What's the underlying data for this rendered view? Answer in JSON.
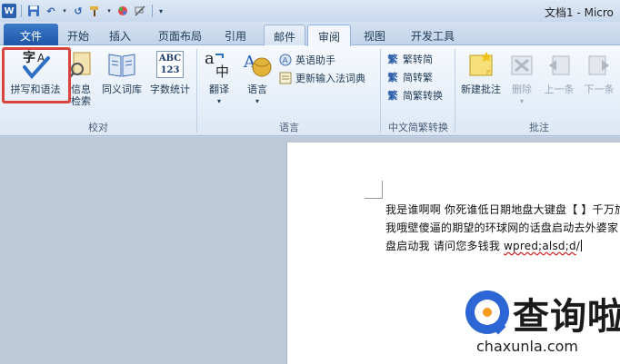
{
  "window": {
    "title": "文档1 - Micro"
  },
  "qat": {
    "app_icon": "W",
    "undo_icon": "↶",
    "redo_icon": "↺"
  },
  "tabs": {
    "file": "文件",
    "home": "开始",
    "insert": "插入",
    "layout": "页面布局",
    "references": "引用",
    "mailings": "邮件",
    "review": "审阅",
    "view": "视图",
    "developer": "开发工具"
  },
  "ribbon": {
    "proofing": {
      "label": "校对",
      "spelling": "拼写和语法",
      "research_line1": "信息",
      "research_line2": "检索",
      "thesaurus": "同义词库",
      "word_count": "字数统计",
      "word_count_icon_text": "ABC\n123"
    },
    "language": {
      "label": "语言",
      "translate": "翻译",
      "language": "语言",
      "english_assistant": "英语助手",
      "update_ime": "更新输入法词典"
    },
    "chinese_conversion": {
      "label": "中文简繁转换",
      "to_simplified": "繁转简",
      "to_traditional": "简转繁",
      "conversion": "简繁转换"
    },
    "comments": {
      "label": "批注",
      "new_comment": "新建批注",
      "delete": "删除",
      "previous": "上一条",
      "next": "下一条"
    }
  },
  "document": {
    "line1": "我是谁啊啊 你死谁低日期地盘大键盘【 】千万旅",
    "line2": "我哦壁傻逼的期望的环球网的话盘启动去外婆家",
    "line3_prefix": "盘启动我 请问您多钱我 ",
    "line3_misspelled": "wpred;alsd;d",
    "line3_after": "/"
  },
  "watermark": {
    "text": "查询啦",
    "url": "chaxunla.com"
  },
  "colors": {
    "file_tab": "#2b62b8",
    "highlight": "#d9443e",
    "watermark_blue": "#2b66d4",
    "watermark_orange": "#f39c1f"
  }
}
